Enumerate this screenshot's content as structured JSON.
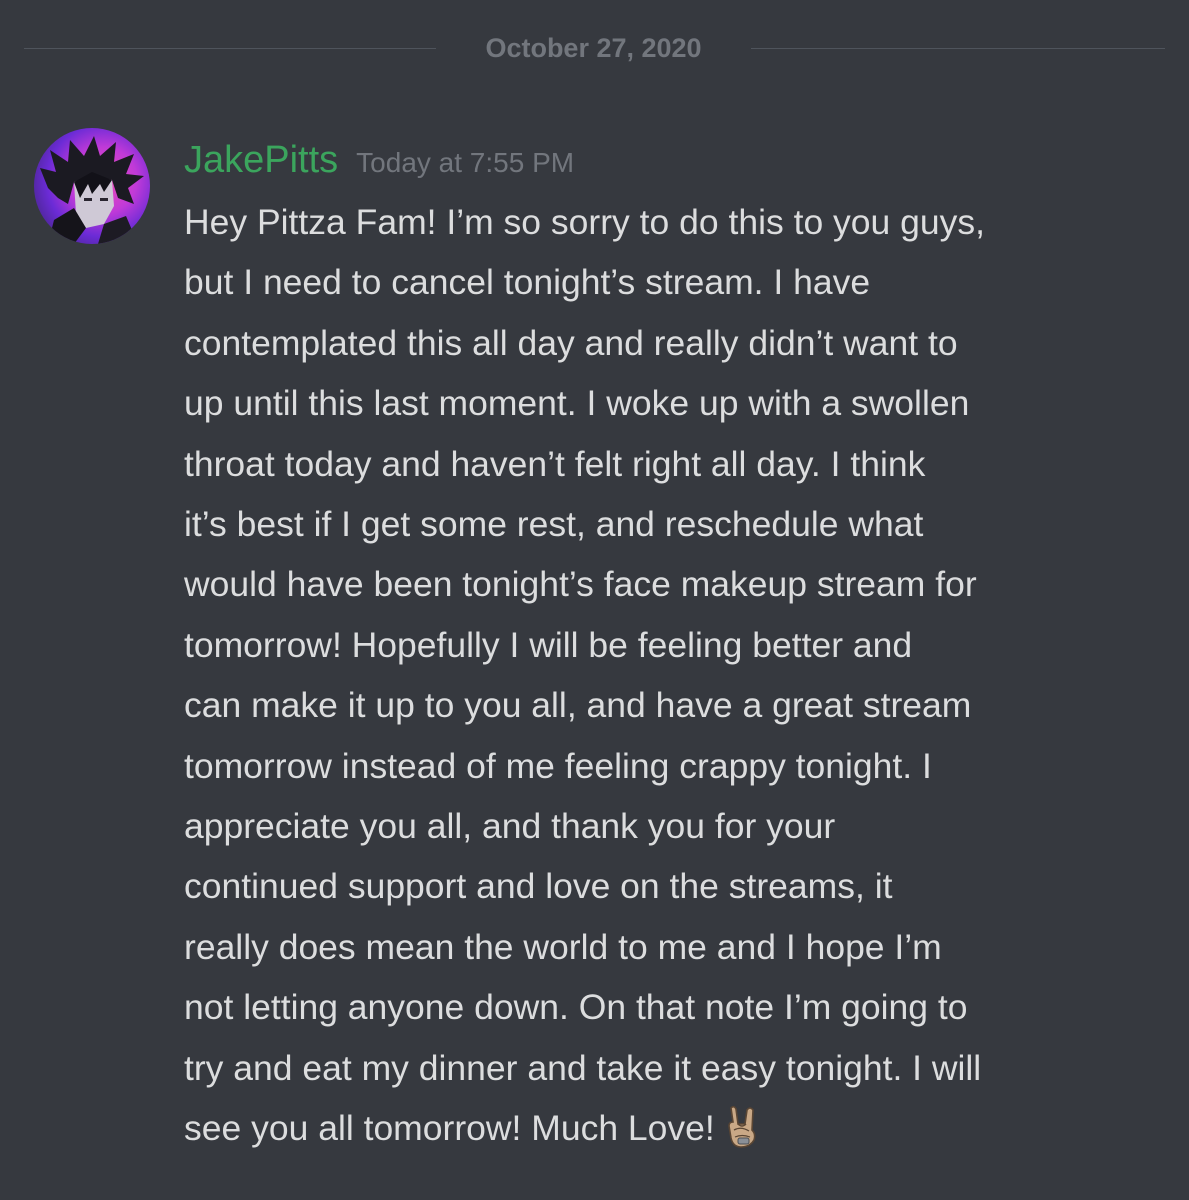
{
  "date_divider": {
    "label": "October 27, 2020"
  },
  "message": {
    "author": "JakePitts",
    "timestamp": "Today at 7:55 PM",
    "text": "Hey Pittza Fam! I’m so sorry to do this to you guys,\nbut I need to cancel tonight’s stream. I have\ncontemplated this all day and really didn’t want to\nup until this last moment. I woke up with a swollen\nthroat today and haven’t felt right all day. I think\nit’s best if I get some rest, and reschedule what\nwould have been tonight’s face makeup stream for\ntomorrow! Hopefully I will be feeling better and\ncan make it up to you all, and have a great stream\ntomorrow instead of me feeling crappy tonight. I\nappreciate you all, and thank you for your\ncontinued support and love on the streams, it\nreally does mean the world to me and I hope I’m\nnot letting anyone down. On that note I’m going to\ntry and eat my dinner and take it easy tonight. I will\nsee you all tomorrow! Much Love!",
    "emoji": "sign-of-the-horns-icon",
    "avatar": "avatar-image"
  },
  "colors": {
    "background": "#36393f",
    "username": "#3ba55d",
    "timestamp": "#72767d",
    "text": "#dcddde",
    "divider": "#4f545c"
  }
}
